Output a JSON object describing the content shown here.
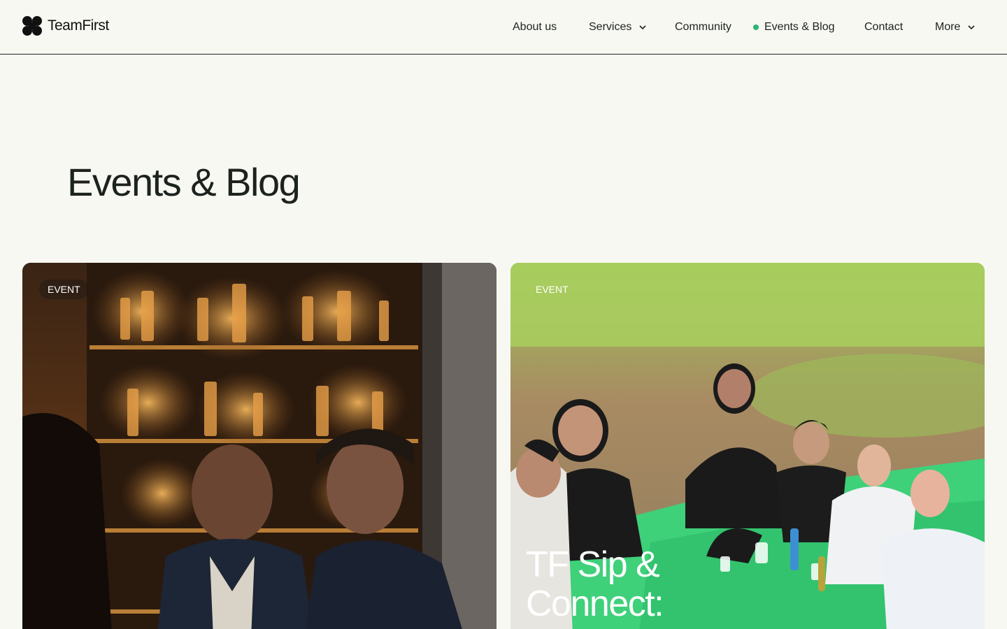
{
  "brand": {
    "name": "TeamFirst"
  },
  "nav": {
    "items": [
      {
        "label": "About us"
      },
      {
        "label": "Services"
      },
      {
        "label": "Community"
      },
      {
        "label": "Events & Blog"
      },
      {
        "label": "Contact"
      },
      {
        "label": "More"
      }
    ]
  },
  "page": {
    "title": "Events & Blog"
  },
  "cards": [
    {
      "badge": "EVENT",
      "title": ""
    },
    {
      "badge": "EVENT",
      "title": "TF Sip & Connect:"
    }
  ],
  "colors": {
    "background": "#f8f8f2",
    "text": "#1c231f",
    "active_dot": "#2bb673",
    "line": "#1c231f"
  }
}
